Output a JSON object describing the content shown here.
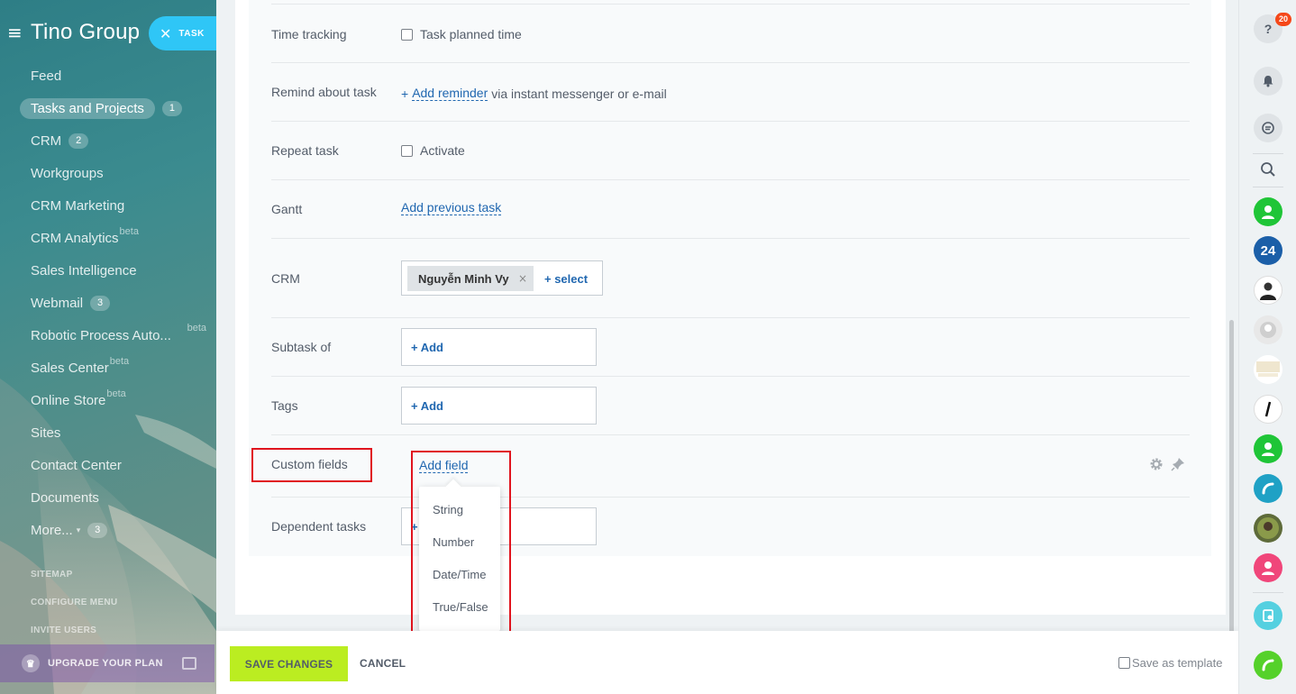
{
  "sidebar": {
    "logo": "Tino Group",
    "task_label": "TASK",
    "items": [
      {
        "label": "Feed"
      },
      {
        "label": "Tasks and Projects",
        "counter": "1"
      },
      {
        "label": "CRM",
        "counter": "2"
      },
      {
        "label": "Workgroups"
      },
      {
        "label": "CRM Marketing"
      },
      {
        "label": "CRM Analytics",
        "beta": "beta"
      },
      {
        "label": "Sales Intelligence"
      },
      {
        "label": "Webmail",
        "counter": "3"
      },
      {
        "label": "Robotic Process Auto...",
        "beta": "beta"
      },
      {
        "label": "Sales Center",
        "beta": "beta"
      },
      {
        "label": "Online Store",
        "beta": "beta"
      },
      {
        "label": "Sites"
      },
      {
        "label": "Contact Center"
      },
      {
        "label": "Documents"
      },
      {
        "label": "More...",
        "counter": "3"
      }
    ],
    "small_links": [
      "SITEMAP",
      "CONFIGURE MENU",
      "INVITE USERS"
    ],
    "upgrade": "UPGRADE YOUR PLAN"
  },
  "form": {
    "time_tracking": {
      "label": "Time tracking",
      "option": "Task planned time"
    },
    "remind": {
      "label": "Remind about task",
      "plus": "+",
      "link": "Add reminder",
      "suffix": "via instant messenger or e-mail"
    },
    "repeat": {
      "label": "Repeat task",
      "option": "Activate"
    },
    "gantt": {
      "label": "Gantt",
      "link": "Add previous task"
    },
    "crm": {
      "label": "CRM",
      "tag": "Nguyễn Minh Vy",
      "remove": "×",
      "select": "+ select"
    },
    "subtask": {
      "label": "Subtask of",
      "add": "+ Add"
    },
    "tags": {
      "label": "Tags",
      "add": "+ Add"
    },
    "custom_fields": {
      "label": "Custom fields",
      "link": "Add field"
    },
    "dependent": {
      "label": "Dependent tasks",
      "add": "+"
    }
  },
  "dropdown": {
    "items": [
      "String",
      "Number",
      "Date/Time",
      "True/False"
    ]
  },
  "footer": {
    "save": "SAVE CHANGES",
    "cancel": "CANCEL",
    "template": "Save as template"
  },
  "rightbar": {
    "help_badge": "20",
    "avatar_24": "24"
  }
}
